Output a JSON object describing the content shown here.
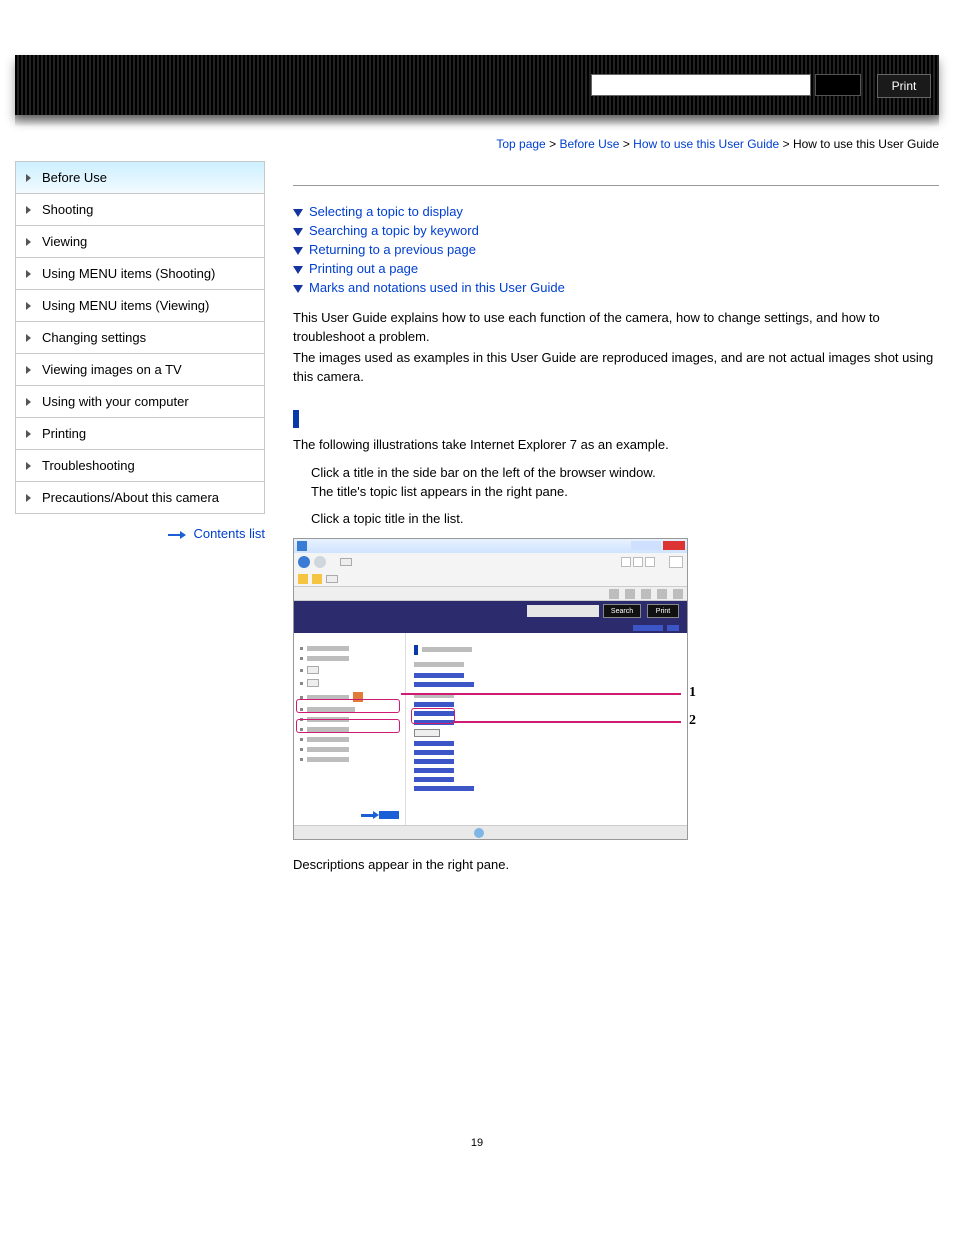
{
  "header": {
    "search_placeholder": "",
    "search_btn": "",
    "print_btn": "Print"
  },
  "breadcrumb": {
    "items": [
      "Top page",
      "Before Use",
      "How to use this User Guide",
      "How to use this User Guide"
    ],
    "sep": ">"
  },
  "sidebar": {
    "items": [
      "Before Use",
      "Shooting",
      "Viewing",
      "Using MENU items (Shooting)",
      "Using MENU items (Viewing)",
      "Changing settings",
      "Viewing images on a TV",
      "Using with your computer",
      "Printing",
      "Troubleshooting",
      "Precautions/About this camera"
    ],
    "active_index": 0,
    "contents_list": "Contents list"
  },
  "content": {
    "jump_links": [
      "Selecting a topic to display",
      "Searching a topic by keyword",
      "Returning to a previous page",
      "Printing out a page",
      "Marks and notations used in this User Guide"
    ],
    "intro_1": "This User Guide explains how to use each function of the camera, how to change settings, and how to troubleshoot a problem.",
    "intro_2": "The images used as examples in this User Guide are reproduced images, and are not actual images shot using this camera.",
    "section_heading": "",
    "illus_caption": "The following illustrations take Internet Explorer 7 as an example.",
    "steps": [
      "Click a title in the side bar on the left of the browser window.",
      "The title's topic list appears in the right pane.",
      "Click a topic title in the list."
    ],
    "illus_btn_a": "Search",
    "illus_btn_b": "Print",
    "callout_1": "1",
    "callout_2": "2",
    "after_illus": "Descriptions appear in the right pane."
  },
  "page_number": "19"
}
